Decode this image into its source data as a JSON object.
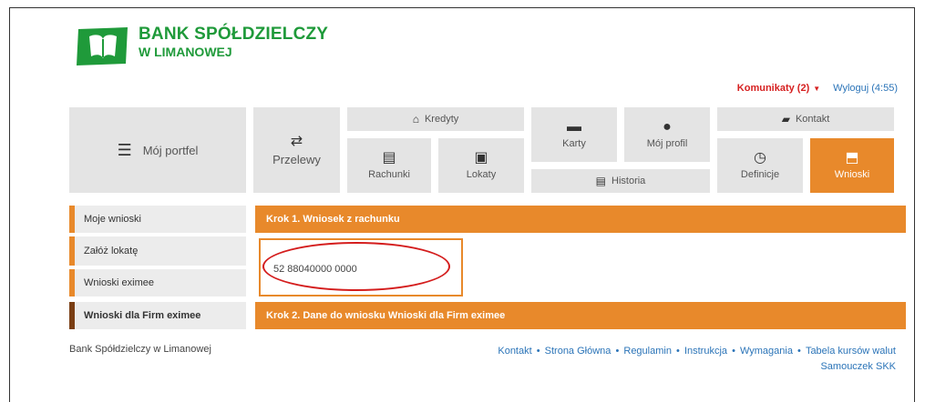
{
  "logo": {
    "line1": "BANK SPÓŁDZIELCZY",
    "line2": "W LIMANOWEJ",
    "color": "#1f9a3a"
  },
  "header": {
    "komunikaty": "Komunikaty (2)",
    "wyloguj": "Wyloguj (4:55)"
  },
  "nav": {
    "moj_portfel": "Mój portfel",
    "przelewy": "Przelewy",
    "kredyty": "Kredyty",
    "rachunki": "Rachunki",
    "lokaty": "Lokaty",
    "karty": "Karty",
    "moj_profil": "Mój profil",
    "historia": "Historia",
    "kontakt": "Kontakt",
    "definicje": "Definicje",
    "wnioski": "Wnioski"
  },
  "sidebar": {
    "items": [
      {
        "label": "Moje wnioski"
      },
      {
        "label": "Załóż lokatę"
      },
      {
        "label": "Wnioski eximee"
      },
      {
        "label": "Wnioski dla Firm eximee"
      }
    ]
  },
  "main": {
    "step1": "Krok 1. Wniosek z rachunku",
    "account_number": "52 88040000 0000",
    "step2": "Krok 2. Dane do wniosku Wnioski dla Firm eximee"
  },
  "footer": {
    "bank_name": "Bank Spółdzielczy w Limanowej",
    "links": [
      "Kontakt",
      "Strona Główna",
      "Regulamin",
      "Instrukcja",
      "Wymagania",
      "Tabela kursów walut",
      "Samouczek SKK"
    ]
  },
  "colors": {
    "accent": "#e8892b",
    "alert": "#d62020",
    "link": "#2b74b8",
    "tile": "#e4e4e4"
  }
}
